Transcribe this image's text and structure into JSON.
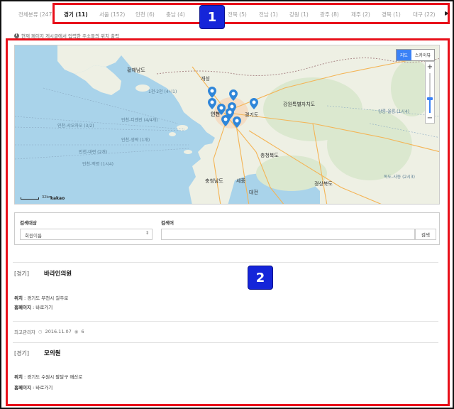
{
  "tabs": [
    {
      "label": "전체분류 (247)",
      "active": false
    },
    {
      "label": "경기 (11)",
      "active": true
    },
    {
      "label": "서울 (152)",
      "active": false
    },
    {
      "label": "인천 (6)",
      "active": false
    },
    {
      "label": "충남 (4)",
      "active": false
    },
    {
      "label": "전북 (5)",
      "active": false
    },
    {
      "label": "전남 (1)",
      "active": false
    },
    {
      "label": "강원 (1)",
      "active": false
    },
    {
      "label": "광주 (8)",
      "active": false
    },
    {
      "label": "제주 (2)",
      "active": false
    },
    {
      "label": "경북 (1)",
      "active": false
    },
    {
      "label": "대구 (22)",
      "active": false
    }
  ],
  "annotations": {
    "badge1": "1",
    "badge2": "2",
    "color": "#e8101a",
    "badge_color": "#1525d9"
  },
  "notice": "현재 페이지 게시글에서 입력한 주소들의 위치 출력",
  "map": {
    "type_buttons": {
      "map": "지도",
      "skyview": "스카이뷰"
    },
    "zoom_in": "+",
    "zoom_out": "−",
    "zoom_level": 0.64,
    "scale_label": "32km",
    "provider": "kakao",
    "labels": {
      "hwanghae": "황해남도",
      "kaesong": "개성",
      "incheon": "인천",
      "gyeonggi": "경기도",
      "gangwon": "강원특별자치도",
      "chungbuk": "충청북도",
      "chungnam": "충청남도",
      "sejong": "세종",
      "daejeon": "대전",
      "gyeongbuk": "경상북도",
      "sea1": "인천-티엔진 (4/4개)",
      "sea2": "인천-샤오차오 (3/2)",
      "sea3": "인천-생략 (1개)",
      "sea4": "인천-대련 (2개)",
      "sea5": "인천-백령 (1시4)",
      "sea6": "1천·2천 (4시1)",
      "sea7": "강릉-울릉 (1시4)",
      "sea8": "독도-사동 (2시3)"
    },
    "marker_color": "#2f86d9"
  },
  "search": {
    "target_label": "검색대상",
    "target_value": "회원이름",
    "keyword_label": "검색어",
    "keyword_value": "",
    "button": "검색"
  },
  "posts": [
    {
      "category": "[경기]",
      "title": "바라인의원",
      "location_label": "위치",
      "location": "경기도 부천시 길주로",
      "homepage_label": "홈페이지",
      "homepage": "바로가기",
      "author": "최고관리자",
      "date": "2016.11.07",
      "views": "6"
    },
    {
      "category": "[경기]",
      "title": "모의원",
      "location_label": "위치",
      "location": "경기도 수원시 팔달구 매산로",
      "homepage_label": "홈페이지",
      "homepage": "바로가기"
    }
  ]
}
